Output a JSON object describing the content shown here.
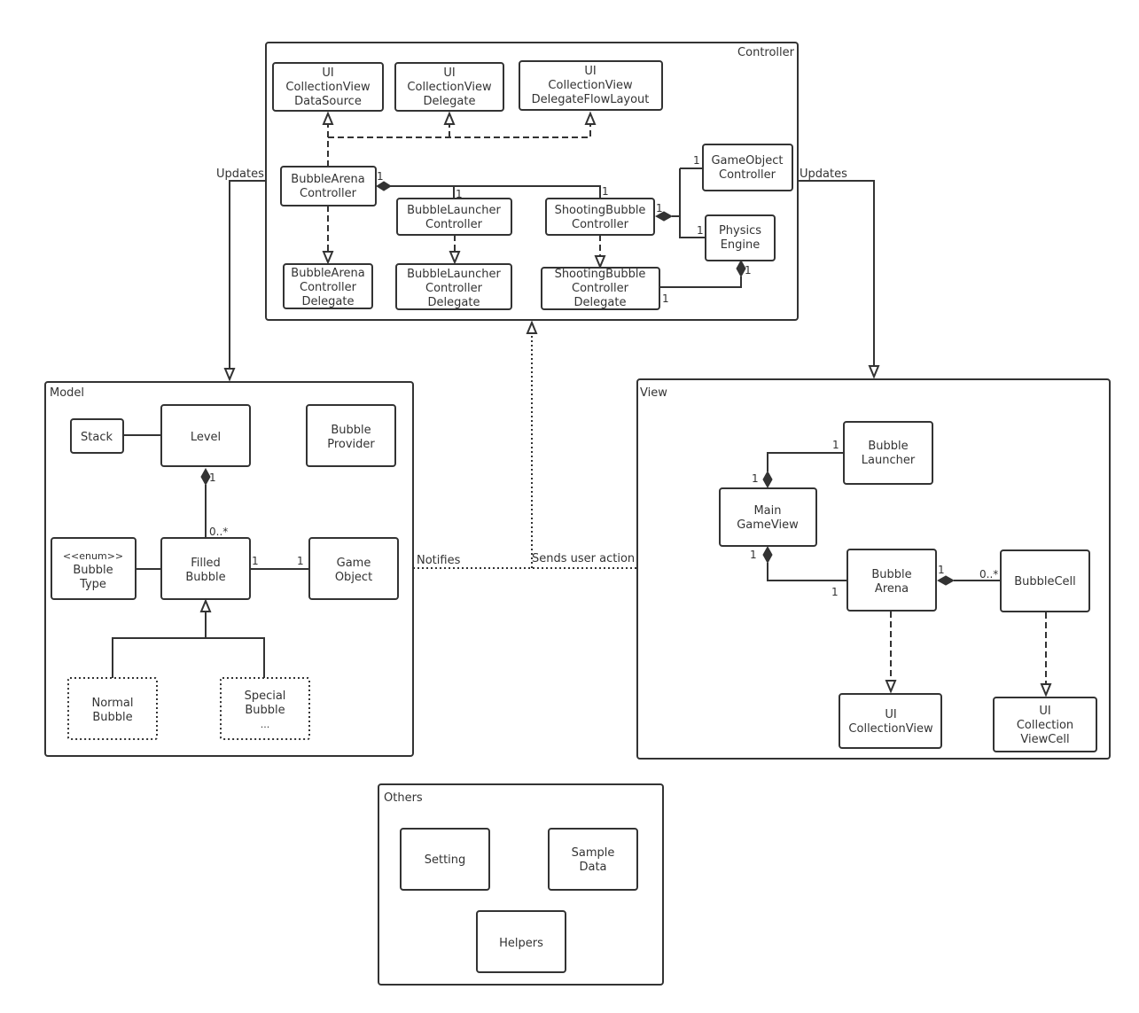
{
  "diagram": {
    "type": "UML class/package diagram",
    "packages": {
      "controller": {
        "label": "Controller",
        "classes": {
          "ui_cv_datasource": [
            "UI",
            "CollectionView",
            "DataSource"
          ],
          "ui_cv_delegate": [
            "UI",
            "CollectionView",
            "Delegate"
          ],
          "ui_cv_flowlayout": [
            "UI",
            "CollectionView",
            "DelegateFlowLayout"
          ],
          "bubble_arena_controller": [
            "BubbleArena",
            "Controller"
          ],
          "bubble_launcher_controller": [
            "BubbleLauncher",
            "Controller"
          ],
          "shooting_bubble_controller": [
            "ShootingBubble",
            "Controller"
          ],
          "gameobject_controller": [
            "GameObject",
            "Controller"
          ],
          "physics_engine": [
            "Physics",
            "Engine"
          ],
          "bubble_arena_controller_delegate": [
            "BubbleArena",
            "Controller",
            "Delegate"
          ],
          "bubble_launcher_controller_delegate": [
            "BubbleLauncher",
            "Controller",
            "Delegate"
          ],
          "shooting_bubble_controller_delegate": [
            "ShootingBubble",
            "Controller",
            "Delegate"
          ]
        },
        "multiplicities": {
          "bac_comp": "1",
          "blc": "1",
          "sbc_top": "1",
          "sbc_comp": "1",
          "goc": "1",
          "pe": "1",
          "pe_comp": "1",
          "sbcd": "1"
        }
      },
      "model": {
        "label": "Model",
        "classes": {
          "stack": [
            "Stack"
          ],
          "level": [
            "Level"
          ],
          "bubble_provider": [
            "Bubble",
            "Provider"
          ],
          "bubble_type": [
            "<<enum>>",
            "Bubble",
            "Type"
          ],
          "filled_bubble": [
            "Filled",
            "Bubble"
          ],
          "game_object": [
            "Game",
            "Object"
          ],
          "normal_bubble": [
            "Normal",
            "Bubble"
          ],
          "special_bubble": [
            "Special",
            "Bubble",
            "..."
          ]
        },
        "multiplicities": {
          "level_comp": "1",
          "filled_many": "0..*",
          "filled_go": "1",
          "go_filled": "1"
        }
      },
      "view": {
        "label": "View",
        "classes": {
          "bubble_launcher": [
            "Bubble",
            "Launcher"
          ],
          "main_gameview": [
            "Main",
            "GameView"
          ],
          "bubble_arena": [
            "Bubble",
            "Arena"
          ],
          "bubble_cell": [
            "BubbleCell"
          ],
          "ui_collectionview": [
            "UI",
            "CollectionView"
          ],
          "ui_collectionviewcell": [
            "UI",
            "Collection",
            "ViewCell"
          ]
        },
        "multiplicities": {
          "bl": "1",
          "mgv_top": "1",
          "mgv_bottom": "1",
          "ba_left": "1",
          "ba_right": "1",
          "cell_many": "0..*"
        }
      },
      "others": {
        "label": "Others",
        "classes": {
          "setting": [
            "Setting"
          ],
          "sample_data": [
            "Sample",
            "Data"
          ],
          "helpers": [
            "Helpers"
          ]
        }
      }
    },
    "relations": {
      "controller_updates_model": "Updates",
      "controller_updates_view": "Updates",
      "model_notifies": "Notifies",
      "view_sends_action": "Sends user action"
    }
  }
}
